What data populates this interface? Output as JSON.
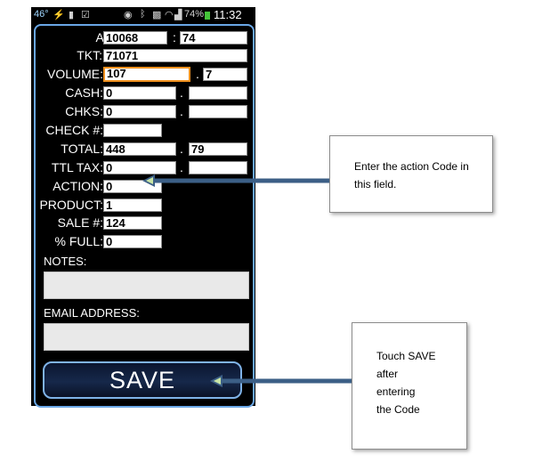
{
  "statusbar": {
    "temp": "46°",
    "battery": "74%",
    "time": "11:32 AM"
  },
  "form": {
    "acct": {
      "label": "ACCT:",
      "value1": "10068",
      "sep": ":",
      "value2": "74"
    },
    "tkt": {
      "label": "TKT:",
      "value": "71071"
    },
    "volume": {
      "label": "VOLUME:",
      "value1": "107",
      "sep": ".",
      "value2": "7"
    },
    "cash": {
      "label": "CASH:",
      "value1": "0",
      "sep": ".",
      "value2": ""
    },
    "chks": {
      "label": "CHKS:",
      "value1": "0",
      "sep": ".",
      "value2": ""
    },
    "check_no": {
      "label": "CHECK #:",
      "value": ""
    },
    "total": {
      "label": "TOTAL:",
      "value1": "448",
      "sep": ".",
      "value2": "79"
    },
    "ttl_tax": {
      "label": "TTL TAX:",
      "value1": "0",
      "sep": ".",
      "value2": ""
    },
    "action": {
      "label": "ACTION:",
      "value": "0"
    },
    "product": {
      "label": "PRODUCT:",
      "value": "1"
    },
    "sale_no": {
      "label": "SALE #:",
      "value": "124"
    },
    "pct_full": {
      "label": "% FULL:",
      "value": "0"
    },
    "notes": {
      "label": "NOTES:",
      "value": ""
    },
    "email": {
      "label": "EMAIL ADDRESS:",
      "value": ""
    },
    "save_label": "SAVE"
  },
  "callouts": {
    "action": {
      "line1": "Enter the action Code in",
      "line2": "this field."
    },
    "save": {
      "line1": "Touch SAVE",
      "line2": "after",
      "line3": "entering",
      "line4": "the Code"
    }
  }
}
